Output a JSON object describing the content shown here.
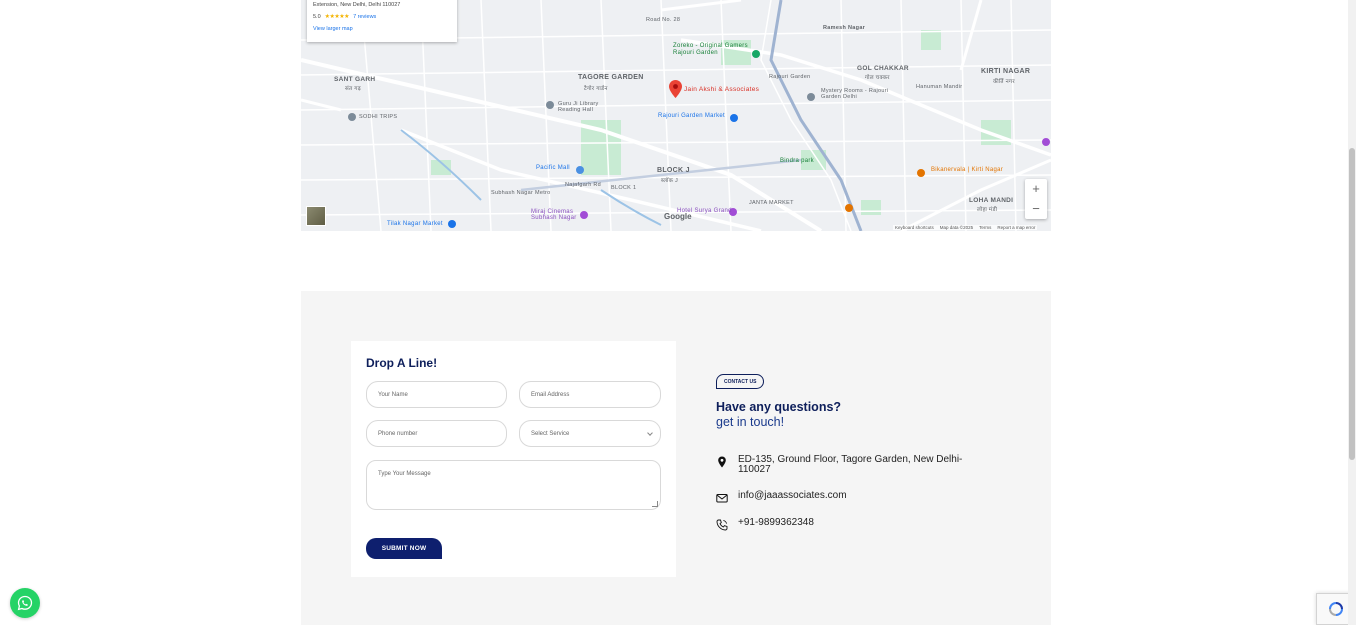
{
  "map": {
    "card": {
      "address": "Extension, New Delhi, Delhi 110027",
      "rating": "5.0",
      "stars": "★★★★★",
      "reviews": "7 reviews",
      "larger_map": "View larger map"
    },
    "place_name": "Jain Akshi & Associates",
    "labels": {
      "tagore_garden": "TAGORE GARDEN",
      "tagore_garden_hi": "टैगोर गार्डन",
      "sant_garh": "SANT GARH",
      "sant_garh_hi": "संत गढ़",
      "kirti_nagar": "KIRTI NAGAR",
      "kirti_nagar_hi": "कीर्ति नगर",
      "gol_chakkar": "GOL CHAKKAR",
      "gol_chakkar_hi": "गोल चक्कर",
      "block_j": "BLOCK J",
      "block_j_hi": "ब्लॉक J",
      "loha_mandi": "LOHA MANDI",
      "loha_mandi_hi": "लोहा मंडी",
      "ramesh_nagar": "Ramesh Nagar",
      "rajouri_garden": "Rajouri Garden",
      "rajouri_garden_market": "Rajouri Garden Market",
      "zoreko": "Zoreko - Original Gamers Rajouri Garden",
      "pacific_mall": "Pacific Mall",
      "subhash_nagar_metro": "Subhash Nagar Metro",
      "miraj_cinemas": "Miraj Cinemas Subhash Nagar",
      "hotel_surya": "Hotel Surya Grand",
      "bikanervala": "Bikanervala | Kirti Nagar",
      "mystery_rooms": "Mystery Rooms - Rajouri Garden Delhi",
      "tilak_nagar_market": "Tilak Nagar Market",
      "sodhi_trips": "SODHI TRIPS",
      "guru_ji_library": "Guru Ji Library Reading Hall",
      "hanuman_mandir": "Hanuman Mandir",
      "road_28": "Road No. 28",
      "najafgarh_rd": "Najafgarh Rd",
      "bindra_park": "Bindra park",
      "block_1": "BLOCK 1",
      "janta_market": "JANTA MARKET"
    },
    "footer": {
      "shortcuts": "Keyboard shortcuts",
      "map_data": "Map data ©2025",
      "terms": "Terms",
      "report": "Report a map error"
    },
    "google": "Google",
    "zoom_in": "+",
    "zoom_out": "−"
  },
  "form": {
    "title": "Drop A Line!",
    "name_placeholder": "Your Name",
    "email_placeholder": "Email Address",
    "phone_placeholder": "Phone number",
    "service_selected": "Select Service",
    "message_placeholder": "Type Your Message",
    "submit_label": "SUBMIT NOW"
  },
  "contact": {
    "badge": "CONTACT US",
    "heading": "Have any questions?",
    "subheading": "get in touch!",
    "address": "ED-135, Ground Floor, Tagore Garden, New Delhi-110027",
    "email": "info@jaaassociates.com",
    "phone": "+91-9899362348"
  },
  "colors": {
    "navy": "#0e1f5b",
    "button": "#0e1f6e",
    "whatsapp": "#25d366",
    "section_bg": "#f5f5f5"
  }
}
